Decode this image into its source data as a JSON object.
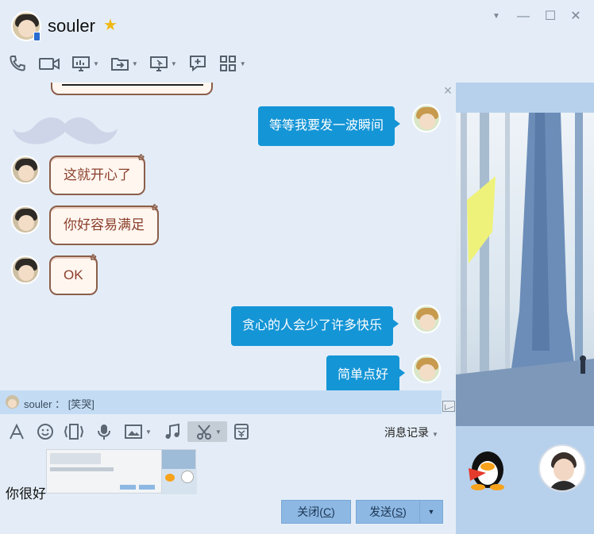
{
  "window": {
    "contact_name": "souler",
    "controls": [
      "dropdown-icon",
      "minimize-icon",
      "maximize-icon",
      "close-icon"
    ]
  },
  "top_toolbar": [
    {
      "icon": "phone-icon"
    },
    {
      "icon": "video-icon"
    },
    {
      "icon": "screen-share-icon"
    },
    {
      "icon": "file-transfer-icon"
    },
    {
      "icon": "remote-desktop-icon"
    },
    {
      "icon": "add-message-icon"
    },
    {
      "icon": "apps-icon"
    }
  ],
  "messages": [
    {
      "side": "out",
      "text": "等等我要发一波瞬间"
    },
    {
      "side": "in",
      "text": "这就开心了"
    },
    {
      "side": "in",
      "text": "你好容易满足"
    },
    {
      "side": "in",
      "text": "OK"
    },
    {
      "side": "out",
      "text": "贪心的人会少了许多快乐"
    },
    {
      "side": "out",
      "text": "简单点好"
    }
  ],
  "notification": {
    "sender": "souler",
    "separator": "：",
    "text": "[笑哭]"
  },
  "input_toolbar": {
    "icons": [
      "font-icon",
      "emoji-icon",
      "shake-icon",
      "voice-icon",
      "image-icon",
      "music-icon",
      "screenshot-icon",
      "red-packet-icon"
    ],
    "history_label": "消息记录"
  },
  "input": {
    "text": "你很好"
  },
  "buttons": {
    "close_label": "关闭",
    "close_hotkey": "C",
    "send_label": "发送",
    "send_hotkey": "S"
  },
  "colors": {
    "bubble_out": "#1495d6",
    "bubble_in_border": "#8b5e4a",
    "bubble_in_text": "#8b3f2a",
    "send_button": "#8db8e3"
  }
}
